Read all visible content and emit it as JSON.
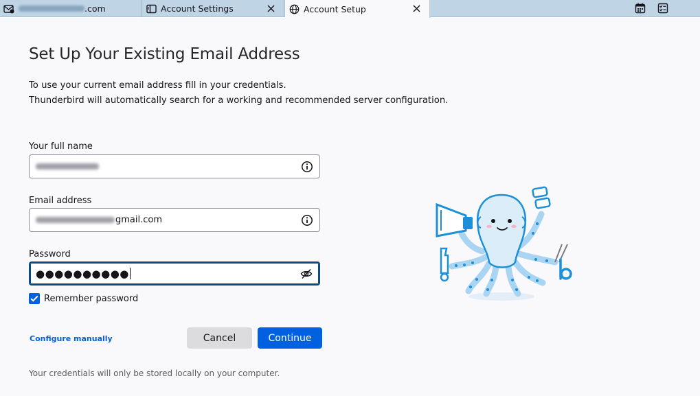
{
  "tabs": [
    {
      "label_suffix": ".com",
      "icon": "mail-icon",
      "label_blurred": true
    },
    {
      "label": "Account Settings",
      "icon": "account-settings-icon"
    },
    {
      "label": "Account Setup",
      "icon": "globe-icon",
      "active": true
    }
  ],
  "toolbar_icons": [
    "calendar-icon",
    "tasks-icon"
  ],
  "page": {
    "title": "Set Up Your Existing Email Address",
    "intro_line1": "To use your current email address fill in your credentials.",
    "intro_line2": "Thunderbird will automatically search for a working and recommended server configuration."
  },
  "form": {
    "name_label": "Your full name",
    "email_label": "Email address",
    "email_domain": "gmail.com",
    "password_label": "Password",
    "password_mask": "●●●●●●●●●●",
    "remember_label": "Remember password",
    "remember_checked": true
  },
  "actions": {
    "configure_manually": "Configure manually",
    "cancel": "Cancel",
    "continue": "Continue"
  },
  "footer": {
    "note": "Your credentials will only be stored locally on your computer."
  },
  "colors": {
    "accent": "#0061e0",
    "tabbar": "#bfd5e6",
    "focus_border": "#0a4c86"
  }
}
